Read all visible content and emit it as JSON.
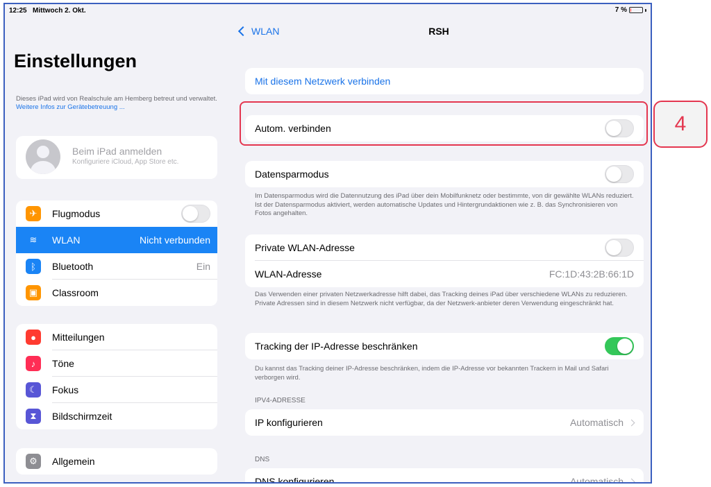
{
  "status": {
    "time": "12:25",
    "date": "Mittwoch 2. Okt.",
    "battery": "7 %",
    "battery_level": 0.07
  },
  "sidebar": {
    "title": "Einstellungen",
    "managed_text": "Dieses iPad wird von Realschule am Hemberg betreut und verwaltet.",
    "managed_link": "Weitere Infos zur Gerätebetreuung ...",
    "account_title": "Beim iPad anmelden",
    "account_sub": "Konfiguriere iCloud, App Store etc.",
    "group1": [
      {
        "label": "Flugmodus",
        "icon": "airplane-icon",
        "color": "#ff9500",
        "toggle": false
      },
      {
        "label": "WLAN",
        "value": "Nicht verbunden",
        "icon": "wifi-icon",
        "color": "#1a84f5",
        "selected": true
      },
      {
        "label": "Bluetooth",
        "value": "Ein",
        "icon": "bluetooth-icon",
        "color": "#1a84f5"
      },
      {
        "label": "Classroom",
        "icon": "classroom-icon",
        "color": "#ff9500"
      }
    ],
    "group2": [
      {
        "label": "Mitteilungen",
        "icon": "notifications-icon",
        "color": "#ff3b30"
      },
      {
        "label": "Töne",
        "icon": "sounds-icon",
        "color": "#ff2d55"
      },
      {
        "label": "Fokus",
        "icon": "moon-icon",
        "color": "#5856d6"
      },
      {
        "label": "Bildschirmzeit",
        "icon": "hourglass-icon",
        "color": "#5856d6"
      }
    ],
    "group3": [
      {
        "label": "Allgemein",
        "icon": "gear-icon",
        "color": "#8e8e93"
      }
    ]
  },
  "detail": {
    "back_label": "WLAN",
    "title": "RSH",
    "connect_label": "Mit diesem Netzwerk verbinden",
    "auto_connect_label": "Autom. verbinden",
    "auto_connect_on": false,
    "low_data_label": "Datensparmodus",
    "low_data_on": false,
    "low_data_note": "Im Datensparmodus wird die Datennutzung des iPad über dein Mobilfunknetz oder bestimmte, von dir gewählte WLANs reduziert. Ist der Datensparmodus aktiviert, werden automatische Updates und Hintergrundaktionen wie z. B. das Synchronisieren von Fotos angehalten.",
    "private_addr_label": "Private WLAN-Adresse",
    "private_addr_on": false,
    "wlan_addr_label": "WLAN-Adresse",
    "wlan_addr_value": "FC:1D:43:2B:66:1D",
    "private_note": "Das Verwenden einer privaten Netzwerkadresse hilft dabei, das Tracking deines iPad über verschiedene WLANs zu reduzieren. Private Adressen sind in diesem Netzwerk nicht verfügbar, da der Netzwerk-anbieter deren Verwendung eingeschränkt hat.",
    "tracking_label": "Tracking der IP-Adresse beschränken",
    "tracking_on": true,
    "tracking_note": "Du kannst das Tracking deiner IP-Adresse beschränken, indem die IP-Adresse vor bekannten Trackern in Mail und Safari verborgen wird.",
    "ipv4_header": "IPV4-ADRESSE",
    "ip_config_label": "IP konfigurieren",
    "ip_config_value": "Automatisch",
    "dns_header": "DNS",
    "dns_config_label": "DNS konfigurieren",
    "dns_config_value": "Automatisch"
  },
  "annotation": {
    "callout_number": "4",
    "color": "#e4364f"
  }
}
